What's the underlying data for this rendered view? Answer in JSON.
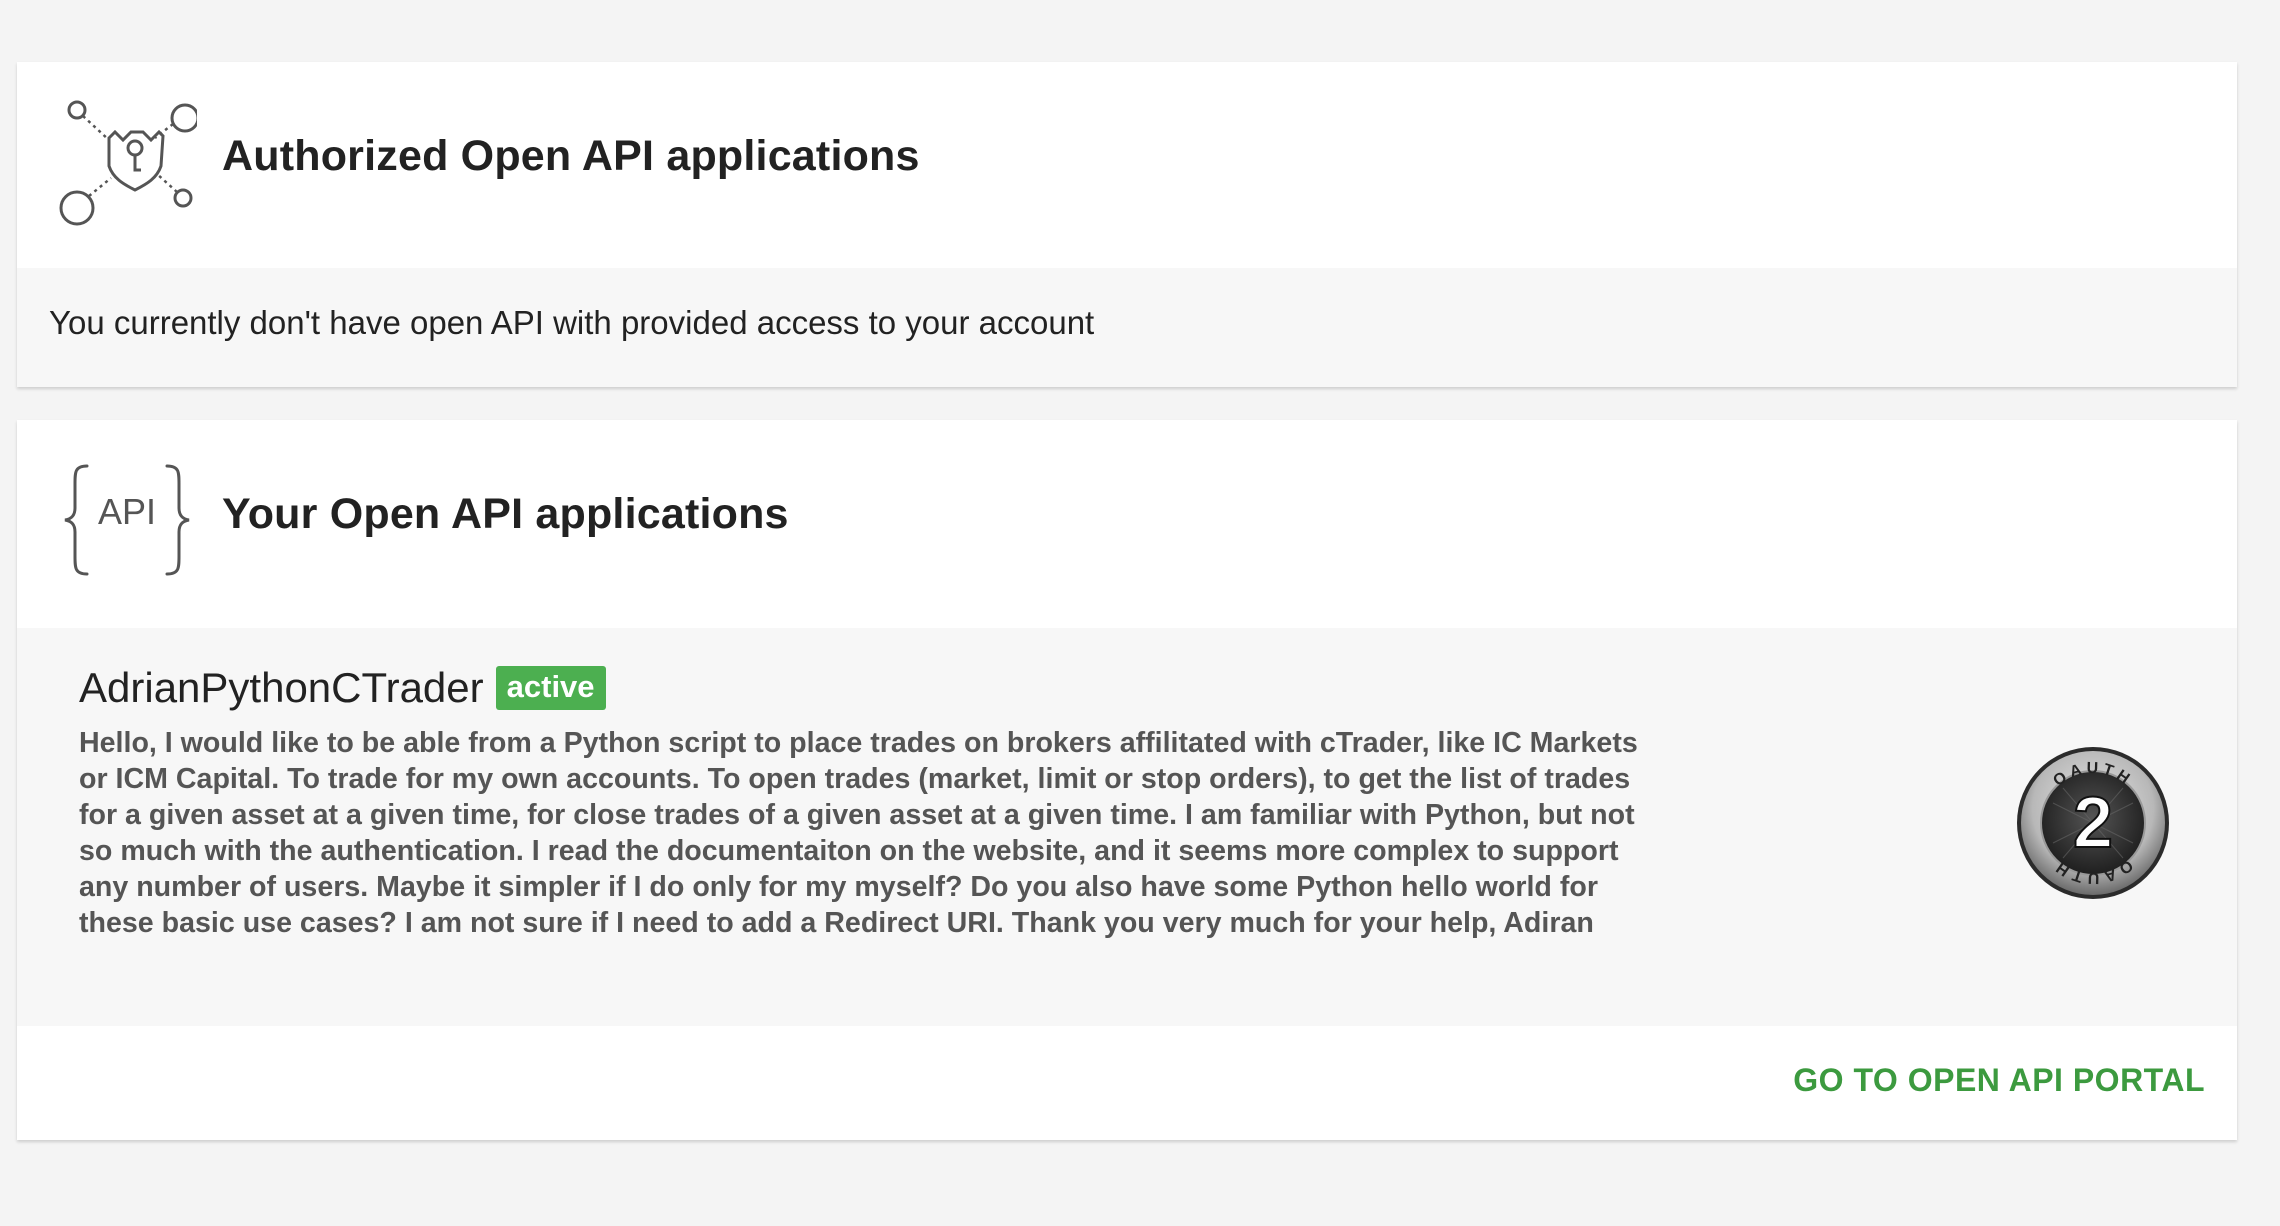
{
  "authorized_section": {
    "title": "Authorized Open API applications",
    "icon": "shield-network-icon",
    "empty_message": "You currently don't have open API with provided access to your account"
  },
  "your_apps_section": {
    "title": "Your Open API applications",
    "icon": "api-braces-icon",
    "icon_text": "API",
    "apps": [
      {
        "name": "AdrianPythonCTrader",
        "status": "active",
        "description": "Hello, I would like to be able from a Python script to place trades on brokers affilitated with cTrader, like IC Markets or ICM Capital. To trade for my own accounts. To open trades (market, limit or stop orders), to get the list of trades for a given asset at a given time, for close trades of a given asset at a given time. I am familiar with Python, but not so much with the authentication. I read the documentaiton on the website, and it seems more complex to support any number of users. Maybe it simpler if I do only for my myself? Do you also have some Python hello world for these basic use cases? I am not sure if I need to add a Redirect URI. Thank you very much for your help, Adiran",
        "logo": "oauth2-logo",
        "logo_text_top": "OAUTH",
        "logo_text_bottom": "OAUTH",
        "logo_number": "2"
      }
    ],
    "portal_link": "GO TO OPEN API PORTAL"
  },
  "colors": {
    "page_background": "#f4f4f4",
    "card_background": "#ffffff",
    "body_background": "#f7f7f7",
    "status_active": "#4caf50",
    "link_green": "#3c9a3f",
    "description_text": "#555555"
  }
}
